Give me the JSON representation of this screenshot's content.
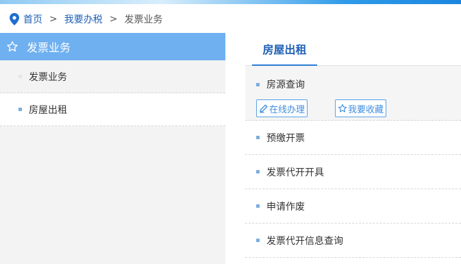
{
  "breadcrumb": {
    "home": "首页",
    "separator": ">",
    "level2": "我要办税",
    "current": "发票业务"
  },
  "sidebar": {
    "title": "发票业务",
    "items": [
      {
        "label": "发票业务"
      },
      {
        "label": "房屋出租"
      }
    ]
  },
  "main": {
    "tab": "房屋出租",
    "items": [
      {
        "label": "房源查询"
      },
      {
        "label": "预缴开票"
      },
      {
        "label": "发票代开开具"
      },
      {
        "label": "申请作废"
      },
      {
        "label": "发票代开信息查询"
      }
    ],
    "actions": {
      "online": "在线办理",
      "favorite": "我要收藏"
    }
  },
  "colors": {
    "accent": "#6fb0f0",
    "link": "#1e5fb4",
    "button": "#3f8ee0"
  }
}
